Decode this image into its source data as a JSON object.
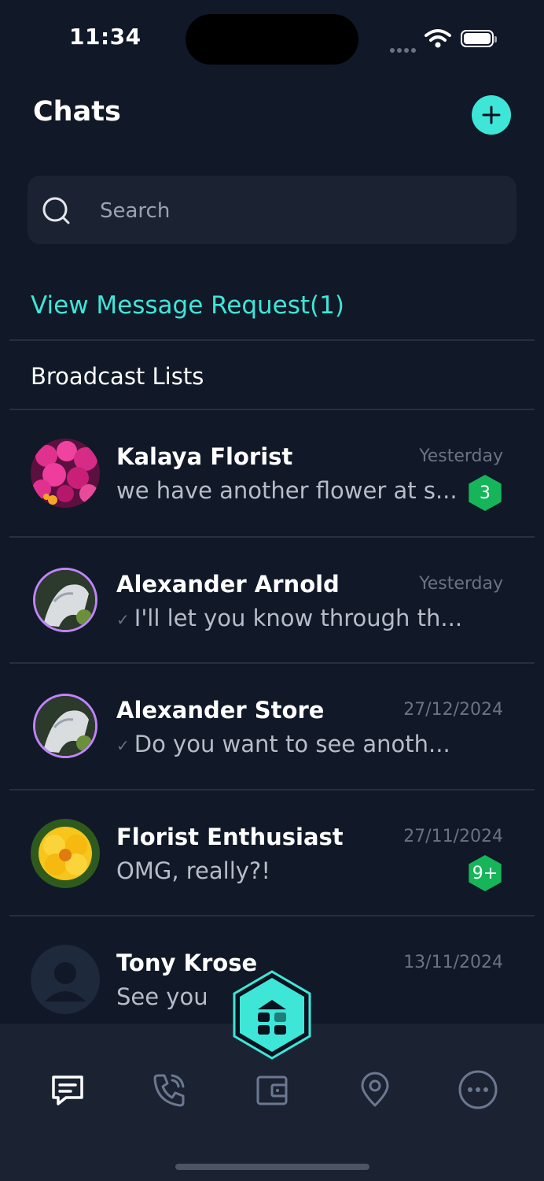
{
  "status_bar": {
    "time": "11:34"
  },
  "header": {
    "title": "Chats"
  },
  "search": {
    "placeholder": "Search"
  },
  "links": {
    "message_request": "View Message Request(1)",
    "broadcast_lists": "Broadcast Lists"
  },
  "chats": [
    {
      "name": "Kalaya Florist",
      "preview": "we have another flower at s...",
      "time": "Yesterday",
      "badge": "3",
      "avatar": "pink-flowers-photo"
    },
    {
      "name": "Alexander Arnold",
      "preview": "I'll let you know through th...",
      "time": "Yesterday",
      "badge": "",
      "avatar": "sculpture-story-photo"
    },
    {
      "name": "Alexander Store",
      "preview": "Do you want to see anoth...",
      "time": "27/12/2024",
      "badge": "",
      "avatar": "sculpture-story-photo"
    },
    {
      "name": "Florist Enthusiast",
      "preview": "OMG, really?!",
      "time": "27/11/2024",
      "badge": "9+",
      "avatar": "yellow-flower-photo"
    },
    {
      "name": "Tony Krose",
      "preview": "See you",
      "time": "13/11/2024",
      "badge": "",
      "avatar": "default-user-avatar"
    }
  ],
  "nav": {
    "items": [
      "chat-icon",
      "phone-icon",
      "wallet-icon",
      "location-pin-icon",
      "more-icon"
    ],
    "center": "home-hex-icon"
  },
  "colors": {
    "accent": "#3ee6d8",
    "badge": "#16b55a",
    "background": "#111827",
    "surface": "#1b2333"
  }
}
